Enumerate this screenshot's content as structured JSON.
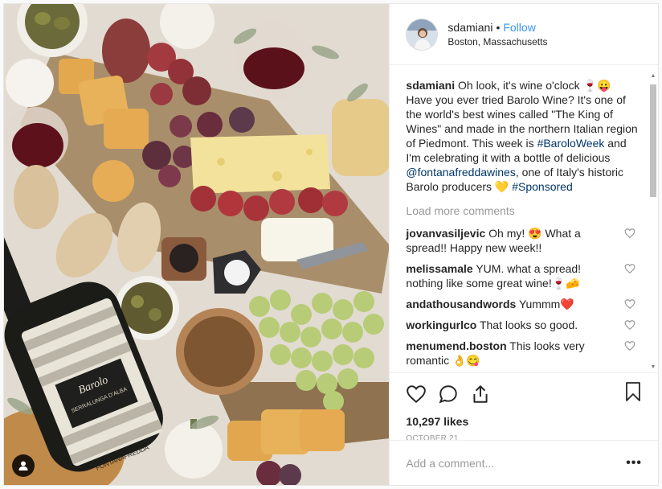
{
  "post": {
    "username": "sdamiani",
    "follow_label": "Follow",
    "dot": "•",
    "location": "Boston, Massachusetts",
    "caption": {
      "username": "sdamiani",
      "text_1": "Oh look, it's wine o'clock 🍷😛 Have you ever tried Barolo Wine? It's one of the world's best wines called \"The King of Wines\" and made in the northern Italian region of Piedmont. This week is ",
      "hashtag_1": "#BaroloWeek",
      "text_2": " and I'm celebrating it with a bottle of delicious ",
      "mention": "@fontanafreddawines",
      "text_3": ", one of Italy's historic Barolo producers 💛 ",
      "hashtag_2": "#Sponsored"
    },
    "load_more": "Load more comments",
    "comments": [
      {
        "username": "jovanvasiljevic",
        "text": "Oh my! 😍 What a spread!! Happy new week!!"
      },
      {
        "username": "melissamale",
        "text": "YUM. what a spread! nothing like some great wine!🍷🧀"
      },
      {
        "username": "andathousandwords",
        "text": "Yummm❤️"
      },
      {
        "username": "workingurlco",
        "text": "That looks so good."
      },
      {
        "username": "menumend.boston",
        "text": "This looks very romantic 👌😋"
      }
    ],
    "likes": "10,297 likes",
    "date": "OCTOBER 21",
    "comment_placeholder": "Add a comment...",
    "more_options": "•••",
    "scroll_up": "▲",
    "scroll_down": "▼"
  },
  "photo": {
    "label_brand": "Barolo",
    "label_sub": "SERRALUNGA D'ALBA",
    "label_bottom": "FONTANAFREDDA"
  },
  "colors": {
    "link": "#003569",
    "follow": "#3897f0",
    "muted": "#999999",
    "heart_red": "#ed4956"
  }
}
